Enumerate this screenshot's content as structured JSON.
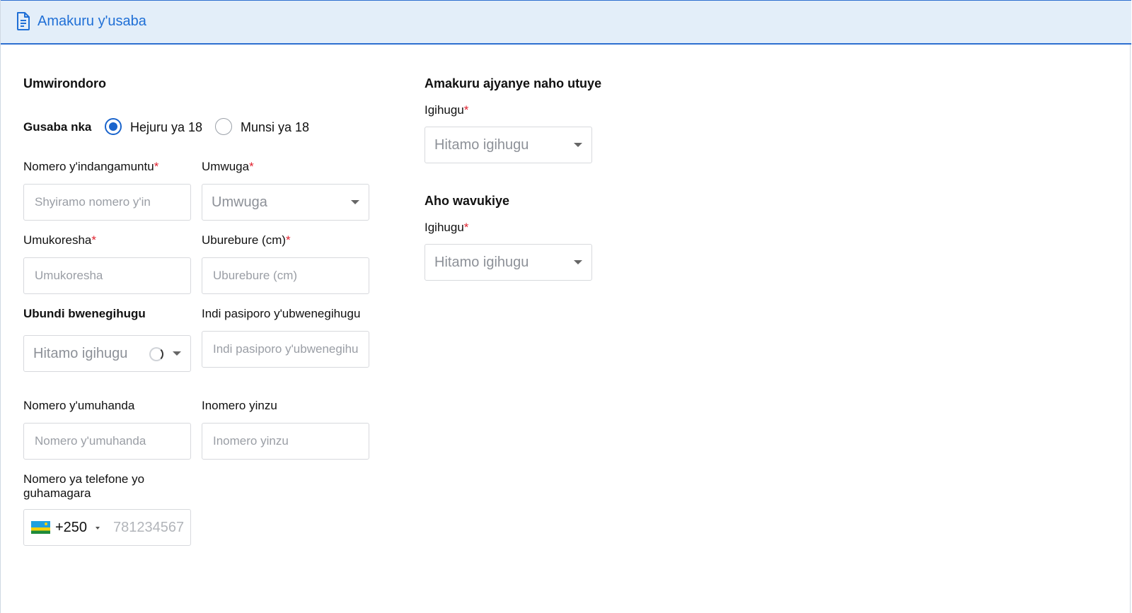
{
  "header": {
    "title": "Amakuru y'usaba",
    "icon": "document-icon",
    "accent": "#1f6fd6",
    "background": "#e3eef9"
  },
  "profile": {
    "section_title": "Umwirondoro",
    "apply_as_label": "Gusaba nka",
    "options": [
      {
        "label": "Hejuru ya 18",
        "checked": true
      },
      {
        "label": "Munsi ya 18",
        "checked": false
      }
    ],
    "id_number": {
      "label": "Nomero y'indangamuntu",
      "required": "*",
      "placeholder": "Shyiramo nomero y'in"
    },
    "occupation": {
      "label": "Umwuga",
      "required": "*",
      "placeholder": "Umwuga"
    },
    "user": {
      "label": "Umukoresha",
      "required": "*",
      "placeholder": "Umukoresha"
    },
    "height": {
      "label": "Uburebure (cm)",
      "required": "*",
      "placeholder": "Uburebure (cm)"
    },
    "other_nationality": {
      "label": "Ubundi bwenegihugu",
      "placeholder": "Hitamo igihugu"
    },
    "other_passport": {
      "label": "Indi pasiporo y'ubwenegihugu",
      "placeholder": "Indi pasiporo y'ubwenegihugu"
    },
    "street_number": {
      "label": "Nomero y'umuhanda",
      "placeholder": "Nomero y'umuhanda"
    },
    "house_number": {
      "label": "Inomero yinzu",
      "placeholder": "Inomero yinzu"
    },
    "emergency_phone": {
      "label": "Nomero ya telefone yo guhamagara",
      "dial_code": "+250",
      "placeholder": "781234567"
    }
  },
  "residence": {
    "section_title": "Amakuru ajyanye naho utuye",
    "country": {
      "label": "Igihugu",
      "required": "*",
      "placeholder": "Hitamo igihugu"
    }
  },
  "departure": {
    "section_title": "Aho wavukiye",
    "country": {
      "label": "Igihugu",
      "required": "*",
      "placeholder": "Hitamo igihugu"
    }
  }
}
